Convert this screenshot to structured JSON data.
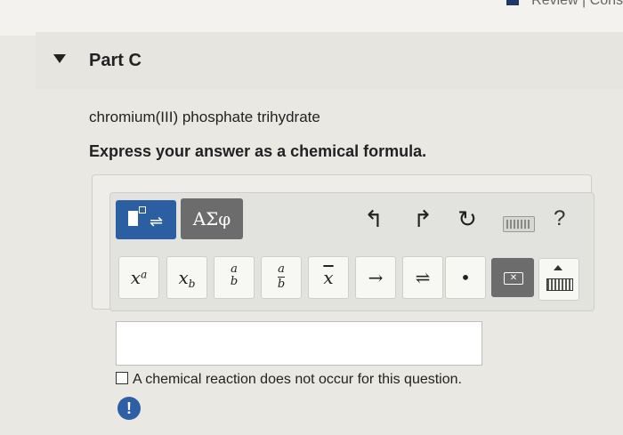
{
  "top_links": {
    "text": "Review | Cons"
  },
  "part": {
    "title": "Part C"
  },
  "question": {
    "text": "chromium(III) phosphate trihydrate",
    "instruction": "Express your answer as a chemical formula."
  },
  "toolbar": {
    "template_button_icon": "templates-icon",
    "greek_label": "ΑΣφ",
    "undo_icon": "↰",
    "redo_icon": "↱",
    "reset_icon": "↻",
    "keyboard_icon": "keyboard-icon",
    "help_label": "?"
  },
  "keys": {
    "superscript": {
      "base": "x",
      "exp": "a"
    },
    "subscript": {
      "base": "x",
      "sub": "b"
    },
    "fraction": {
      "num": "a",
      "den": "b"
    },
    "fraction_bar": {
      "num": "a",
      "den": "b"
    },
    "overline": "x",
    "arrow": "→",
    "equilibrium": "⇌",
    "dot": "•",
    "delete_icon": "✕"
  },
  "answer": {
    "value": ""
  },
  "no_reaction": {
    "label": "A chemical reaction does not occur for this question.",
    "checked": false
  },
  "alert": {
    "icon": "!"
  },
  "colors": {
    "accent": "#2b5fa2",
    "dark_button": "#6c6c6c",
    "background": "#e9e8e3"
  }
}
